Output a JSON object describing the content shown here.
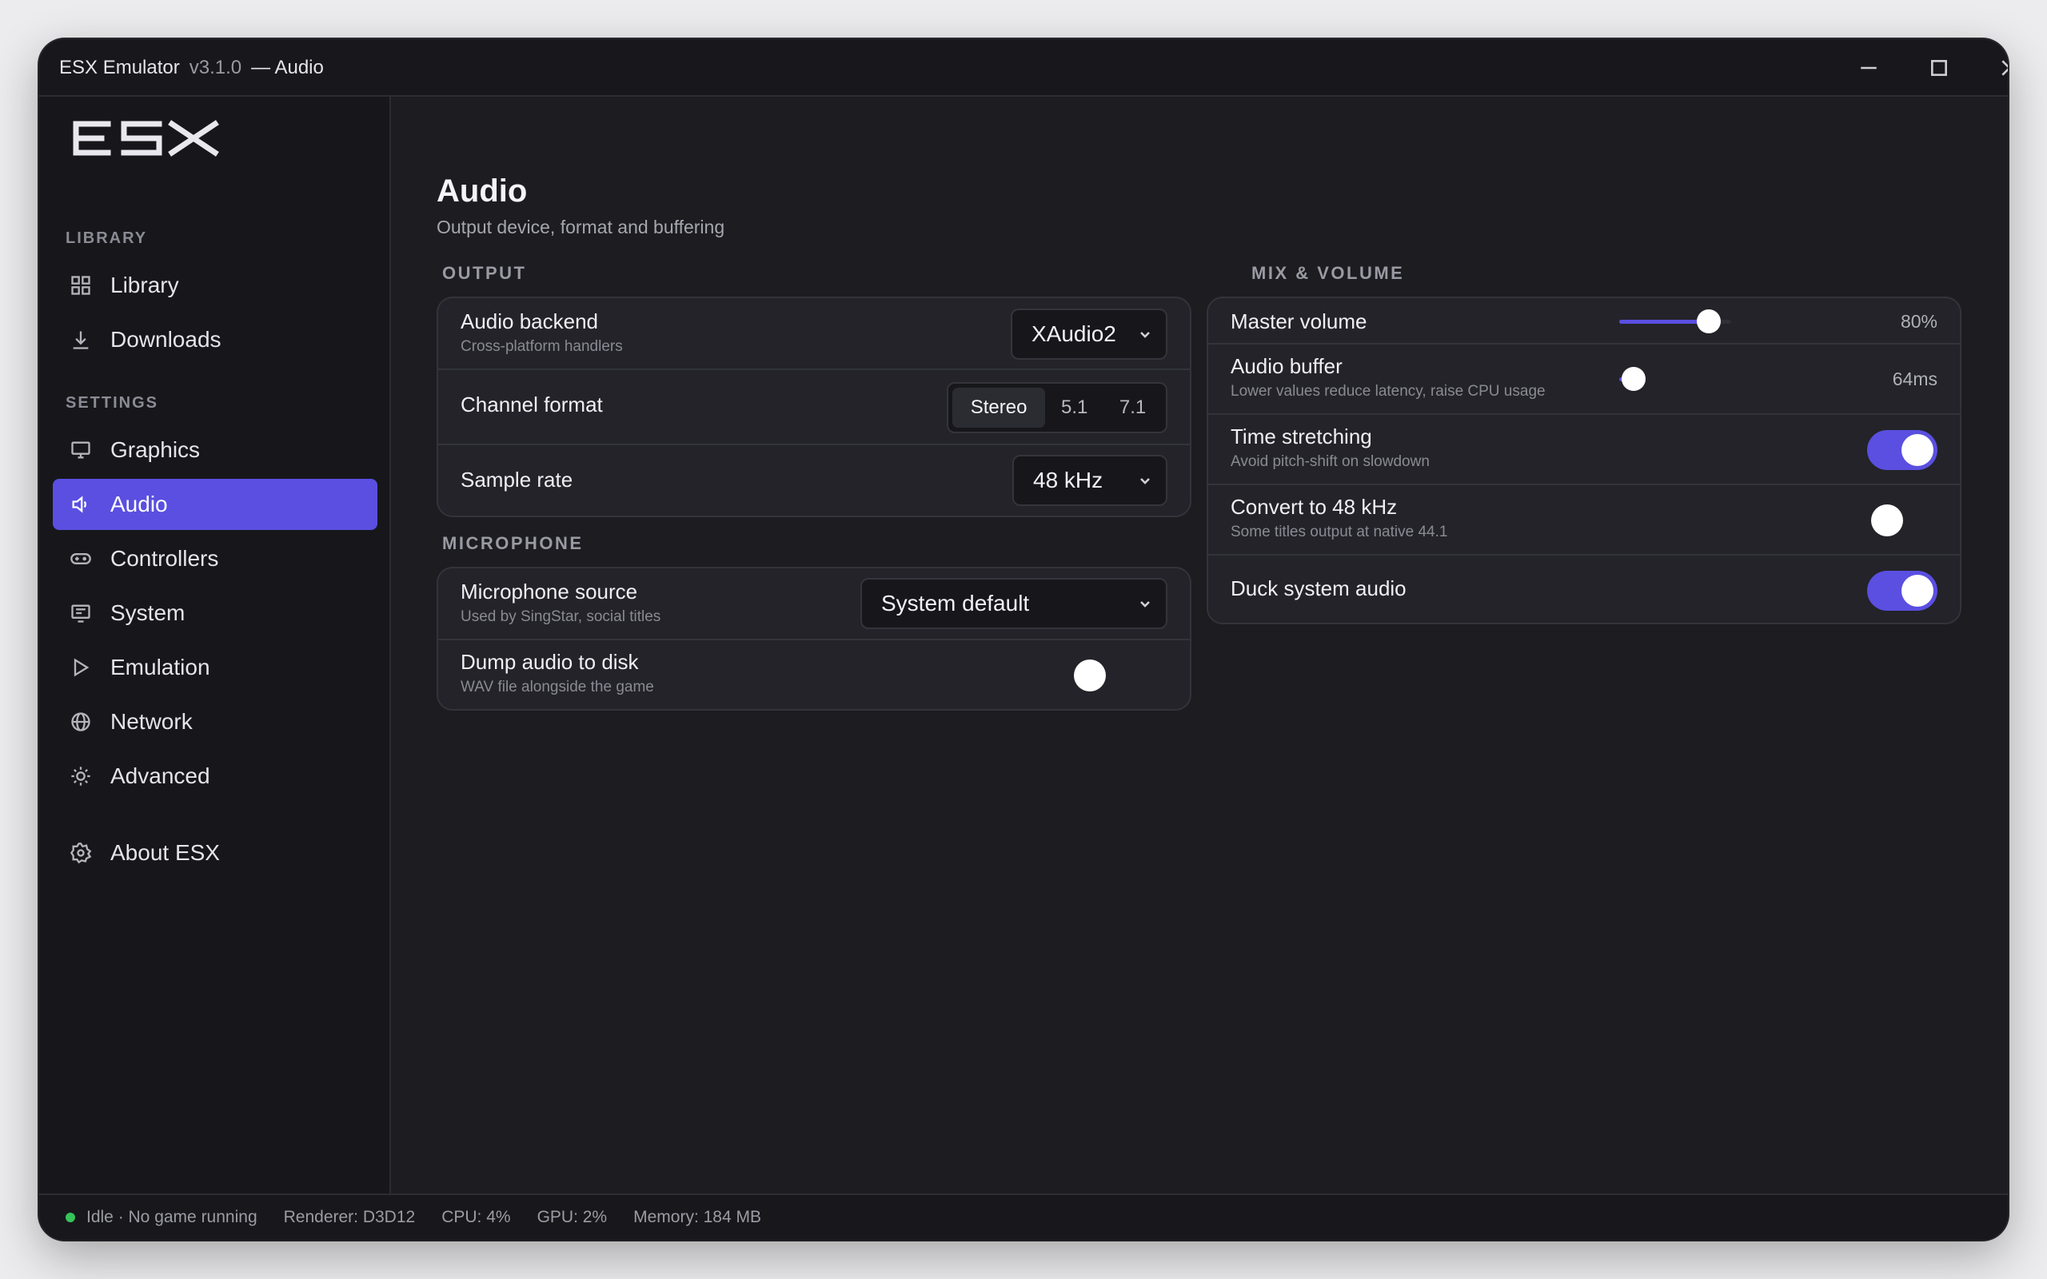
{
  "titlebar": {
    "app": "ESX Emulator",
    "version": "v3.1.0",
    "section": "— Audio"
  },
  "sidebar": {
    "logo": "ESX",
    "library_label": "LIBRARY",
    "library_items": [
      {
        "label": "Library",
        "icon": "grid-icon"
      },
      {
        "label": "Downloads",
        "icon": "download-icon"
      }
    ],
    "settings_label": "SETTINGS",
    "settings_items": [
      {
        "label": "Graphics",
        "icon": "monitor-icon"
      },
      {
        "label": "Audio",
        "icon": "speaker-icon",
        "active": true
      },
      {
        "label": "Controllers",
        "icon": "gamepad-icon"
      },
      {
        "label": "System",
        "icon": "system-icon"
      },
      {
        "label": "Emulation",
        "icon": "play-icon"
      },
      {
        "label": "Network",
        "icon": "globe-icon"
      },
      {
        "label": "Advanced",
        "icon": "sun-icon"
      }
    ],
    "about": {
      "label": "About ESX",
      "icon": "gear-icon"
    }
  },
  "main": {
    "title": "Audio",
    "subtitle": "Output device, format and buffering",
    "output": {
      "label": "OUTPUT",
      "backend": {
        "title": "Audio backend",
        "sub": "Cross-platform handlers",
        "value": "XAudio2"
      },
      "channel": {
        "title": "Channel format",
        "options": [
          "Stereo",
          "5.1",
          "7.1"
        ],
        "selected": "Stereo"
      },
      "sample": {
        "title": "Sample rate",
        "value": "48 kHz"
      }
    },
    "microphone": {
      "label": "MICROPHONE",
      "source": {
        "title": "Microphone source",
        "sub": "Used by SingStar, social titles",
        "value": "System default"
      },
      "dump": {
        "title": "Dump audio to disk",
        "sub": "WAV file alongside the game",
        "on": false
      }
    },
    "mix": {
      "label": "MIX & VOLUME",
      "master": {
        "title": "Master volume",
        "value": "80%",
        "level": 0.8
      },
      "buffer": {
        "title": "Audio buffer",
        "sub": "Lower values reduce latency, raise CPU usage",
        "value": "64ms",
        "level": 0.15
      },
      "stretch": {
        "title": "Time stretching",
        "sub": "Avoid pitch-shift on slowdown",
        "on": true
      },
      "convert": {
        "title": "Convert to 48 kHz",
        "sub": "Some titles output at native 44.1",
        "on": false
      },
      "duck": {
        "title": "Duck system audio",
        "on": true
      }
    }
  },
  "statusbar": {
    "status": "Idle · No game running",
    "renderer": "Renderer: D3D12",
    "cpu": "CPU: 4%",
    "gpu": "GPU: 2%",
    "memory": "Memory: 184 MB",
    "dot_color": "#36c45a"
  },
  "colors": {
    "accent": "#5a4fe0",
    "background": "#1c1c21",
    "card": "#232329"
  }
}
